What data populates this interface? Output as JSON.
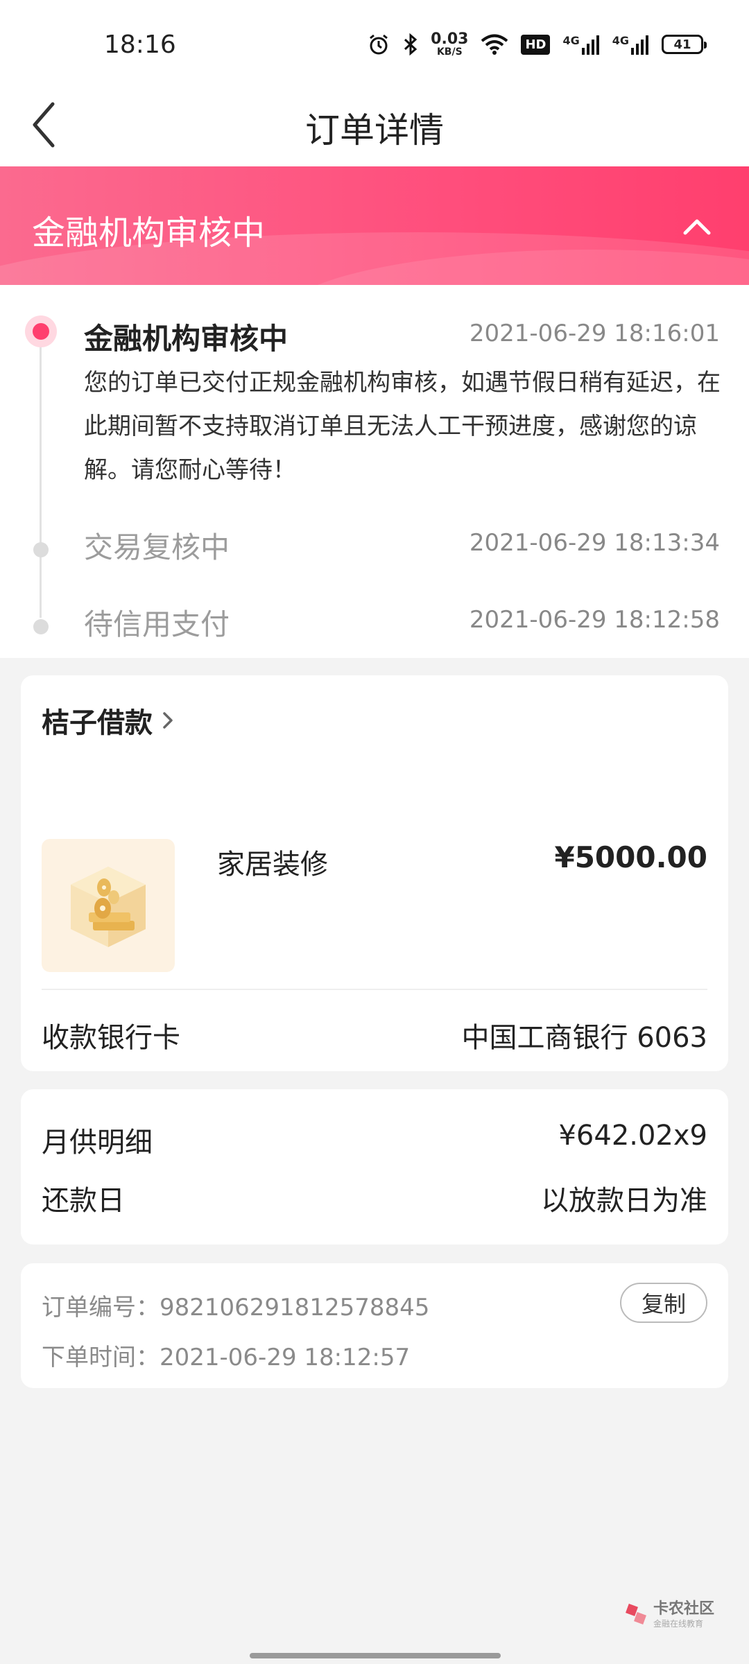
{
  "status_bar": {
    "time": "18:16",
    "net_speed": "0.03",
    "net_unit": "KB/S",
    "hd_label": "HD",
    "signal1_label": "4G",
    "signal2_label": "4G",
    "battery": "41"
  },
  "nav": {
    "title": "订单详情"
  },
  "banner": {
    "title": "金融机构审核中"
  },
  "timeline": {
    "items": [
      {
        "title": "金融机构审核中",
        "time": "2021-06-29 18:16:01",
        "description": "您的订单已交付正规金融机构审核，如遇节假日稍有延迟，在此期间暂不支持取消订单且无法人工干预进度，感谢您的谅解。请您耐心等待！"
      },
      {
        "title": "交易复核中",
        "time": "2021-06-29 18:13:34"
      },
      {
        "title": "待信用支付",
        "time": "2021-06-29 18:12:58"
      }
    ]
  },
  "order": {
    "lender": "桔子借款",
    "product_name": "家居装修",
    "price": "¥5000.00",
    "bank_label": "收款银行卡",
    "bank_value": "中国工商银行 6063"
  },
  "repayment": {
    "monthly_label": "月供明细",
    "monthly_value": "¥642.02x9",
    "day_label": "还款日",
    "day_value": "以放款日为准"
  },
  "meta": {
    "order_no": "订单编号：982106291812578845",
    "order_time": "下单时间：2021-06-29 18:12:57",
    "copy_label": "复制"
  },
  "watermark": {
    "main": "卡农社区",
    "sub": "金融在线教育"
  },
  "colors": {
    "accent": "#ff3f6e",
    "banner_start": "#fb6a8f",
    "background": "#f3f3f3"
  }
}
